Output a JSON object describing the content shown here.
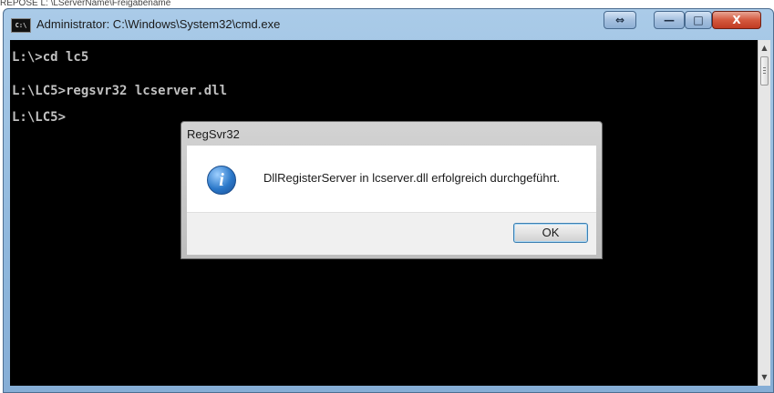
{
  "page_caption": "REPOSE L: \\LServerName\\Freigabename",
  "window": {
    "title": "Administrator: C:\\Windows\\System32\\cmd.exe",
    "icon_label": "C:\\",
    "buttons": {
      "swap": "⇔",
      "minimize": "—",
      "maximize": "□",
      "close": "X"
    }
  },
  "console": {
    "lines": [
      "L:\\>cd lc5",
      "L:\\LC5>regsvr32 lcserver.dll",
      "L:\\LC5>"
    ]
  },
  "scrollbar": {
    "up": "▲",
    "down": "▼"
  },
  "dialog": {
    "title": "RegSvr32",
    "icon_glyph": "i",
    "message": "DllRegisterServer in lcserver.dll erfolgreich durchgeführt.",
    "ok_label": "OK"
  }
}
